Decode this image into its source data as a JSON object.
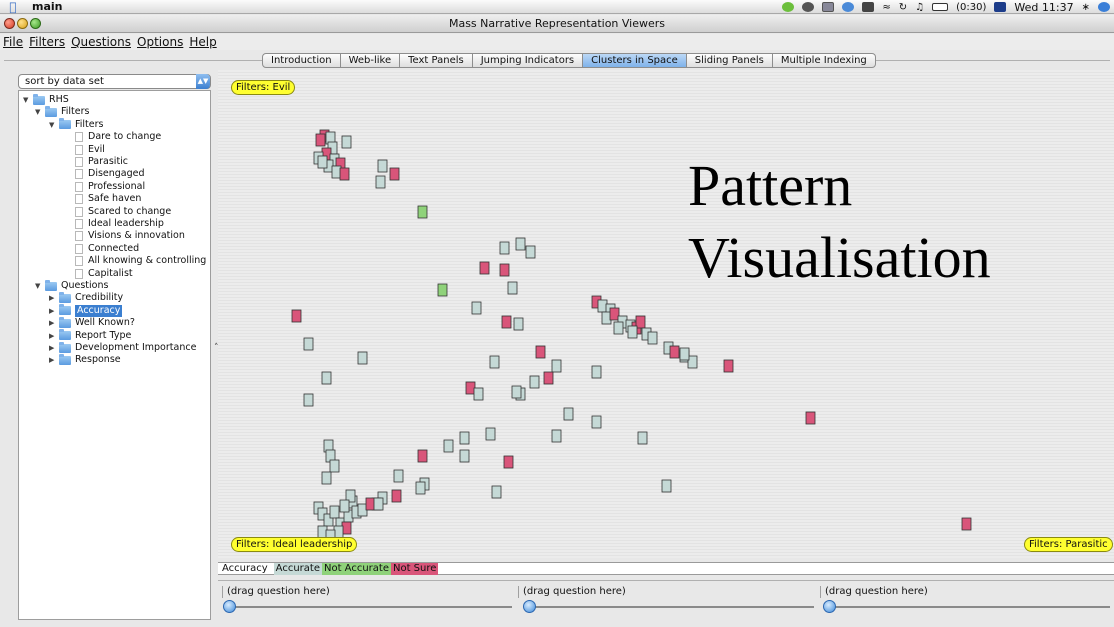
{
  "menubar": {
    "app_name": "main",
    "battery": "(0:30)",
    "clock": "Wed 11:37"
  },
  "window": {
    "title": "Mass Narrative Representation Viewers"
  },
  "menu": [
    "File",
    "Filters",
    "Questions",
    "Options",
    "Help"
  ],
  "tabs": [
    {
      "label": "Introduction",
      "active": false
    },
    {
      "label": "Web-like",
      "active": false
    },
    {
      "label": "Text Panels",
      "active": false
    },
    {
      "label": "Jumping Indicators",
      "active": false
    },
    {
      "label": "Clusters in Space",
      "active": true
    },
    {
      "label": "Sliding Panels",
      "active": false
    },
    {
      "label": "Multiple Indexing",
      "active": false
    }
  ],
  "sort_select": {
    "value": "sort by data set"
  },
  "tree": [
    {
      "label": "RHS",
      "level": 0,
      "kind": "folder",
      "expanded": true
    },
    {
      "label": "Filters",
      "level": 1,
      "kind": "folder",
      "expanded": true
    },
    {
      "label": "Filters",
      "level": 2,
      "kind": "folder",
      "expanded": true
    },
    {
      "label": "Dare to change",
      "level": 3,
      "kind": "doc"
    },
    {
      "label": "Evil",
      "level": 3,
      "kind": "doc"
    },
    {
      "label": "Parasitic",
      "level": 3,
      "kind": "doc"
    },
    {
      "label": "Disengaged",
      "level": 3,
      "kind": "doc"
    },
    {
      "label": "Professional",
      "level": 3,
      "kind": "doc"
    },
    {
      "label": "Safe haven",
      "level": 3,
      "kind": "doc"
    },
    {
      "label": "Scared to change",
      "level": 3,
      "kind": "doc"
    },
    {
      "label": "Ideal leadership",
      "level": 3,
      "kind": "doc"
    },
    {
      "label": "Visions & innovation",
      "level": 3,
      "kind": "doc"
    },
    {
      "label": "Connected",
      "level": 3,
      "kind": "doc"
    },
    {
      "label": "All knowing & controlling",
      "level": 3,
      "kind": "doc"
    },
    {
      "label": "Capitalist",
      "level": 3,
      "kind": "doc"
    },
    {
      "label": "Questions",
      "level": 1,
      "kind": "folder",
      "expanded": true
    },
    {
      "label": "Credibility",
      "level": 2,
      "kind": "folder",
      "expanded": false
    },
    {
      "label": "Accuracy",
      "level": 2,
      "kind": "folder",
      "expanded": false,
      "selected": true
    },
    {
      "label": "Well Known?",
      "level": 2,
      "kind": "folder",
      "expanded": false
    },
    {
      "label": "Report Type",
      "level": 2,
      "kind": "folder",
      "expanded": false
    },
    {
      "label": "Development Importance",
      "level": 2,
      "kind": "folder",
      "expanded": false
    },
    {
      "label": "Response",
      "level": 2,
      "kind": "folder",
      "expanded": false
    }
  ],
  "canvas": {
    "filter_tags": {
      "evil": "Filters: Evil",
      "ideal": "Filters: Ideal leadership",
      "parasitic": "Filters: Parasitic"
    },
    "overlay_text": "Pattern Visualisation"
  },
  "legend": {
    "title": "Accuracy",
    "items": [
      {
        "label": "Accurate",
        "color": "#c5d9d6"
      },
      {
        "label": "Not Accurate",
        "color": "#8fd27a"
      },
      {
        "label": "Not Sure",
        "color": "#d9557a"
      }
    ]
  },
  "drag_slots": [
    "(drag question here)",
    "(drag question here)",
    "(drag question here)"
  ],
  "colors": {
    "accurate": "#c5d9d6",
    "not_accurate": "#8fd27a",
    "not_sure": "#d9557a",
    "filter_tag": "#ffff30",
    "selection": "#3b7fd0"
  }
}
